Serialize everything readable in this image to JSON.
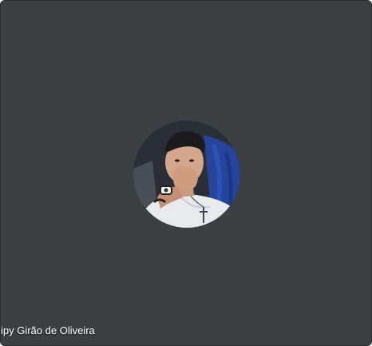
{
  "participant": {
    "name": "ipy Girão de Oliveira",
    "avatar": "profile-photo"
  },
  "colors": {
    "tile_background": "#3c4043",
    "label_text": "#ffffff"
  }
}
